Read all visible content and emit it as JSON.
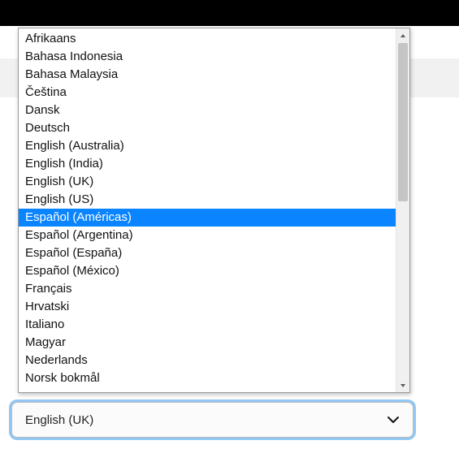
{
  "select": {
    "value": "English (UK)"
  },
  "dropdown": {
    "highlight_index": 10,
    "options": [
      "Afrikaans",
      "Bahasa Indonesia",
      "Bahasa Malaysia",
      "Čeština",
      "Dansk",
      "Deutsch",
      "English (Australia)",
      "English (India)",
      "English (UK)",
      "English (US)",
      "Español (Américas)",
      "Español (Argentina)",
      "Español (España)",
      "Español (México)",
      "Français",
      "Hrvatski",
      "Italiano",
      "Magyar",
      "Nederlands",
      "Norsk bokmål"
    ]
  }
}
